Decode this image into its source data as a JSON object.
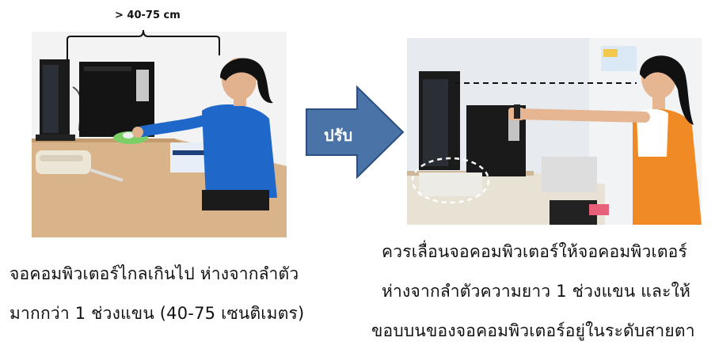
{
  "left_panel": {
    "distance_label": "> 40-75 cm",
    "caption_line1": "จอคอมพิวเตอร์ไกลเกินไป ห่างจากลำตัว",
    "caption_line2": "มากกว่า 1 ช่วงแขน (40-75 เซนติเมตร)"
  },
  "arrow": {
    "label": "ปรับ",
    "color": "#4a73a8"
  },
  "right_panel": {
    "caption_line1": "ควรเลื่อนจอคอมพิวเตอร์ให้จอคอมพิวเตอร์",
    "caption_line2": "ห่างจากลำตัวความยาว 1 ช่วงแขน และให้",
    "caption_line3": "ขอบบนของจอคอมพิวเตอร์อยู่ในระดับสายตา"
  },
  "colors": {
    "shirt_blue": "#1f67c9",
    "shirt_orange": "#f08a24",
    "desk_wood": "#d9b48a",
    "monitor_black": "#1b1b1b"
  }
}
